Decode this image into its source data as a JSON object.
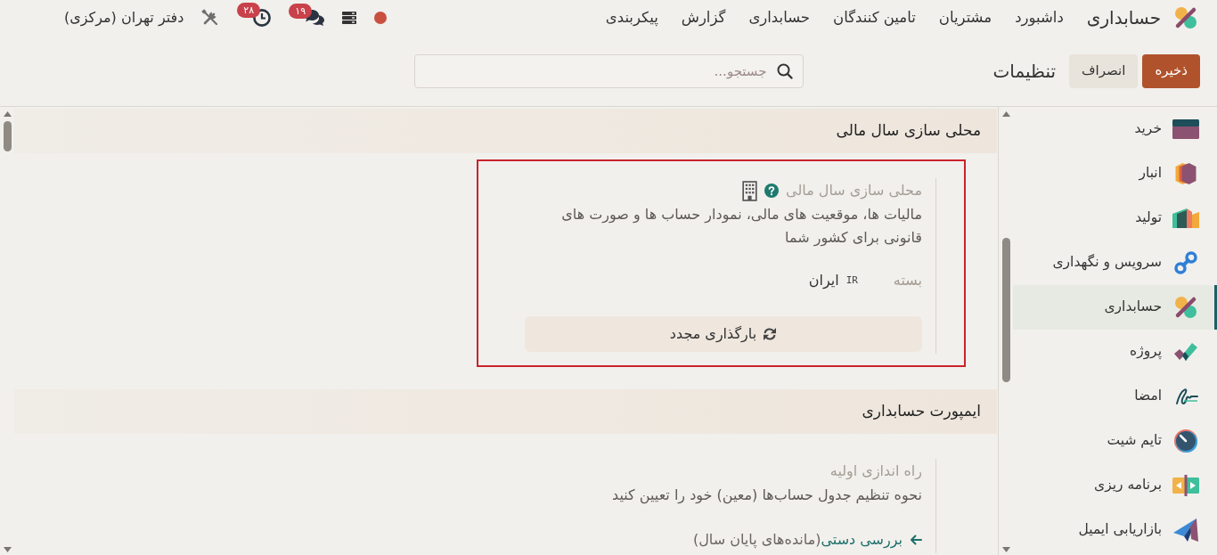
{
  "navbar": {
    "brand": "حسابداری",
    "menu": [
      "داشبورد",
      "مشتریان",
      "تامین کنندگان",
      "حسابداری",
      "گزارش",
      "پیکربندی"
    ],
    "messages_badge": "۱۹",
    "activities_badge": "۲۸",
    "company": "دفتر تهران (مرکزی)"
  },
  "control_panel": {
    "buttons": [
      {
        "label": "ذخیره",
        "kind": "primary"
      },
      {
        "label": "انصراف",
        "kind": "secondary"
      }
    ],
    "title": "تنظیمات",
    "search": {
      "placeholder": "جستجو..."
    }
  },
  "sidebar": {
    "items": [
      {
        "label": "خرید",
        "selected": false
      },
      {
        "label": "انبار",
        "selected": false
      },
      {
        "label": "تولید",
        "selected": false
      },
      {
        "label": "سرویس و نگهداری",
        "selected": false
      },
      {
        "label": "حسابداری",
        "selected": true
      },
      {
        "label": "پروژه",
        "selected": false
      },
      {
        "label": "امضا",
        "selected": false
      },
      {
        "label": "تایم شیت",
        "selected": false
      },
      {
        "label": "برنامه ریزی",
        "selected": false
      },
      {
        "label": "بازاریابی ایمیل",
        "selected": false
      }
    ]
  },
  "sections": [
    {
      "title": "محلی سازی سال مالی",
      "settings": [
        {
          "title": "محلی سازی سال مالی",
          "highlighted": true,
          "help": true,
          "company_specific": true,
          "description": "مالیات ها، موقعیت های مالی، نمودار حساب ها و صورت های قانونی برای کشور شما",
          "field": {
            "label": "بسته",
            "code": "IR",
            "value": "ایران"
          },
          "button": "بارگذاری مجدد"
        }
      ]
    },
    {
      "title": "ایمپورت حسابداری",
      "settings": [
        {
          "title": "راه اندازی اولیه",
          "highlighted": false,
          "help": false,
          "company_specific": false,
          "description": "نحوه تنظیم جدول حساب‌ها (معین) خود را تعیین کنید",
          "links": [
            {
              "label": "بررسی دستی",
              "note": "(مانده‌های پایان سال)"
            }
          ]
        }
      ]
    }
  ]
}
